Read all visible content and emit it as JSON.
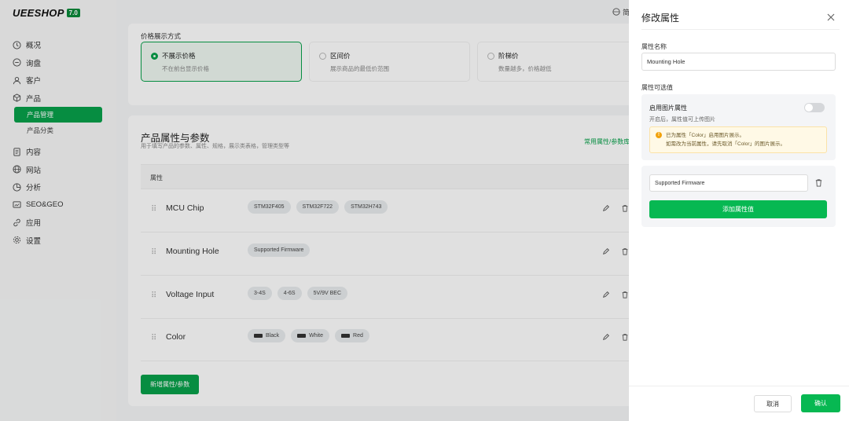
{
  "app": {
    "logo": "UEESHOP",
    "version": "7.0"
  },
  "topbar": {
    "right_text": "简"
  },
  "sidebar": {
    "items": [
      {
        "label": "概况",
        "icon": "clock-icon"
      },
      {
        "label": "询盘",
        "icon": "chat-icon"
      },
      {
        "label": "客户",
        "icon": "user-icon"
      },
      {
        "label": "产品",
        "icon": "box-icon"
      }
    ],
    "sub_items": [
      {
        "label": "产品管理",
        "active": true
      },
      {
        "label": "产品分类",
        "active": false
      }
    ],
    "items2": [
      {
        "label": "内容",
        "icon": "document-icon"
      },
      {
        "label": "网站",
        "icon": "globe-icon"
      },
      {
        "label": "分析",
        "icon": "chart-icon"
      },
      {
        "label": "SEO&GEO",
        "icon": "seo-icon"
      },
      {
        "label": "应用",
        "icon": "link-icon"
      },
      {
        "label": "设置",
        "icon": "gear-icon"
      }
    ]
  },
  "price_display": {
    "label": "价格展示方式",
    "options": [
      {
        "title": "不展示价格",
        "desc": "不在前台显示价格",
        "selected": true
      },
      {
        "title": "区间价",
        "desc": "展示商品的最低价范围",
        "selected": false
      },
      {
        "title": "阶梯价",
        "desc": "数量越多，价格越低",
        "selected": false
      }
    ]
  },
  "attributes": {
    "title": "产品属性与参数",
    "desc": "用于填写产品的参数、属性、规格，展示类表格，管理类型等",
    "link": "常用属性/参数库",
    "column_header": "属性",
    "rows": [
      {
        "name": "MCU Chip",
        "tags": [
          {
            "label": "STM32F405"
          },
          {
            "label": "STM32F722"
          },
          {
            "label": "STM32H743"
          }
        ]
      },
      {
        "name": "Mounting Hole",
        "tags": [
          {
            "label": "Supported Firmware"
          }
        ]
      },
      {
        "name": "Voltage Input",
        "tags": [
          {
            "label": "3-4S"
          },
          {
            "label": "4-6S"
          },
          {
            "label": "5V/9V BEC"
          }
        ]
      },
      {
        "name": "Color",
        "tags": [
          {
            "label": "Black",
            "swatch": true
          },
          {
            "label": "White",
            "swatch": true
          },
          {
            "label": "Red",
            "swatch": true
          }
        ]
      }
    ],
    "add_button": "新增属性/参数"
  },
  "drawer": {
    "title": "修改属性",
    "name_label": "属性名称",
    "name_value": "Mounting Hole",
    "values_label": "属性可选值",
    "image_attr": {
      "title": "启用图片属性",
      "desc": "开启后，属性值可上传图片",
      "enabled": false,
      "warning_line1": "已为属性「Color」启用图片展示。",
      "warning_line2": "如需改为当前属性，请先取消「Color」的图片展示。"
    },
    "value_input": "Supported Firmware",
    "add_value_button": "添加属性值",
    "cancel": "取消",
    "confirm": "确认"
  },
  "colors": {
    "accent": "#07a14a",
    "button": "#07b852"
  }
}
